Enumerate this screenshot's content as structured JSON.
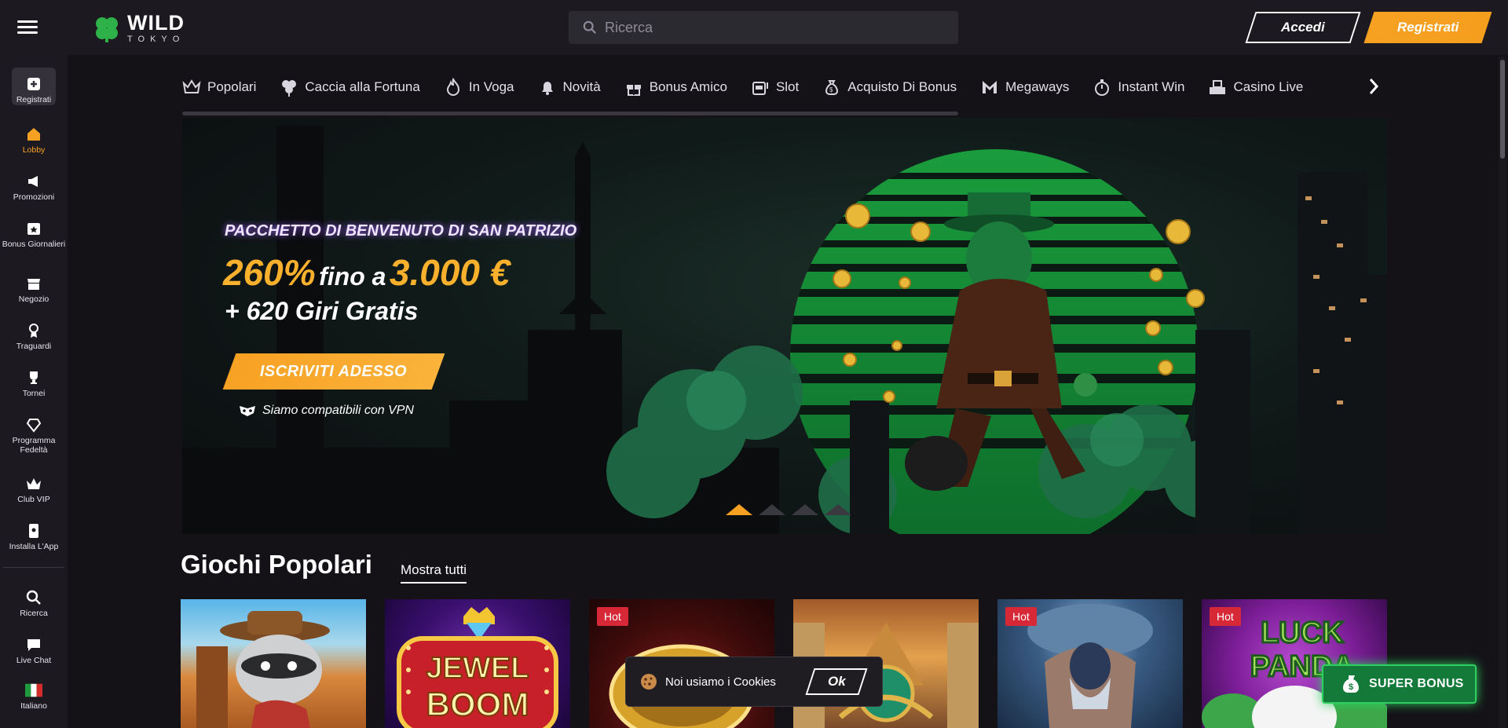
{
  "header": {
    "logo_word": "WILD",
    "logo_sub": "TOKYO",
    "search_placeholder": "Ricerca",
    "login_label": "Accedi",
    "register_label": "Registrati"
  },
  "sidebar": {
    "items": [
      {
        "label": "Registrati",
        "icon": "register-icon"
      },
      {
        "label": "Lobby",
        "icon": "home-icon"
      },
      {
        "label": "Promozioni",
        "icon": "megaphone-icon"
      },
      {
        "label": "Bonus Giornalieri",
        "icon": "calendar-star-icon"
      },
      {
        "label": "Negozio",
        "icon": "shop-icon"
      },
      {
        "label": "Traguardi",
        "icon": "medal-icon"
      },
      {
        "label": "Tornei",
        "icon": "trophy-icon"
      },
      {
        "label": "Programma Fedeltà",
        "icon": "diamond-icon"
      },
      {
        "label": "Club VIP",
        "icon": "crown-icon"
      },
      {
        "label": "Installa L'App",
        "icon": "phone-icon"
      },
      {
        "label": "Ricerca",
        "icon": "search-icon"
      },
      {
        "label": "Live Chat",
        "icon": "chat-icon"
      },
      {
        "label": "Italiano",
        "icon": "italy-flag-icon"
      }
    ],
    "active": "Lobby"
  },
  "categories": [
    {
      "label": "Popolari",
      "icon": "crown-icon"
    },
    {
      "label": "Caccia alla Fortuna",
      "icon": "clover-icon"
    },
    {
      "label": "In Voga",
      "icon": "flame-icon"
    },
    {
      "label": "Novità",
      "icon": "bell-icon"
    },
    {
      "label": "Bonus Amico",
      "icon": "gift-icon"
    },
    {
      "label": "Slot",
      "icon": "slot-machine-icon"
    },
    {
      "label": "Acquisto Di Bonus",
      "icon": "money-bag-icon"
    },
    {
      "label": "Megaways",
      "icon": "megaways-icon"
    },
    {
      "label": "Instant Win",
      "icon": "stopwatch-icon"
    },
    {
      "label": "Casino Live",
      "icon": "casino-icon"
    }
  ],
  "banner": {
    "kicker": "PACCHETTO DI BENVENUTO DI SAN PATRIZIO",
    "pct": "260%",
    "fino": "fino a",
    "amount": "3.000 €",
    "line2": "+ 620 Giri Gratis",
    "cta": "ISCRIVITI ADESSO",
    "vpn": "Siamo compatibili con VPN",
    "slides": 4,
    "active_slide": 1
  },
  "section": {
    "title": "Giochi Popolari",
    "show_all": "Mostra tutti"
  },
  "games": [
    {
      "name": "raccoon-cowboy",
      "hot": ""
    },
    {
      "name": "Jewel Boom",
      "title_line1": "JEWEL",
      "title_line2": "BOOM",
      "hot": ""
    },
    {
      "name": "coins",
      "hot": "Hot"
    },
    {
      "name": "egypt",
      "hot": ""
    },
    {
      "name": "zeus",
      "hot": "Hot"
    },
    {
      "name": "Luck of Panda",
      "title_line1": "LUCK",
      "title_line2": "PANDA",
      "hot": "Hot"
    }
  ],
  "cookie": {
    "text": "Noi usiamo i Cookies",
    "ok": "Ok"
  },
  "super_bonus": "SUPER BONUS",
  "colors": {
    "accent": "#f7a123",
    "green": "#2ed15f",
    "bg": "#141217",
    "panel": "#1c1a20"
  }
}
